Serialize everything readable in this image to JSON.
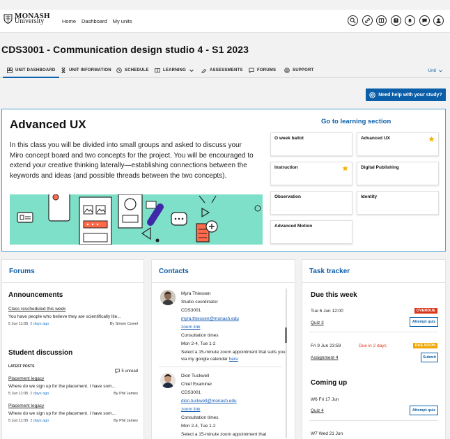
{
  "brand": {
    "line1": "MONASH",
    "line2": "University"
  },
  "nav": [
    "Home",
    "Dashboard",
    "My units"
  ],
  "header_icons": [
    "search-icon",
    "link-icon",
    "book-icon",
    "help-icon",
    "bell-icon",
    "chat-icon",
    "user-icon"
  ],
  "page_title": "CDS3001 - Communication design studio 4 - S1 2023",
  "tabs": [
    {
      "label": "Unit dashboard",
      "icon": "dashboard-icon"
    },
    {
      "label": "Unit information",
      "icon": "hourglass-icon"
    },
    {
      "label": "Schedule",
      "icon": "clock-icon"
    },
    {
      "label": "Learning",
      "icon": "book-icon"
    },
    {
      "label": "Assessments",
      "icon": "assessment-icon"
    },
    {
      "label": "Forums",
      "icon": "chat-icon"
    },
    {
      "label": "Support",
      "icon": "lifebuoy-icon"
    }
  ],
  "unit_menu": "Unit",
  "help_button": "Need help with your study?",
  "hero": {
    "title": "Advanced UX",
    "body": "In this class you will be divided into small groups and asked to discuss your Miro concept board and two concepts for the project. You will be encouraged to extend your creative thinking laterally—establishing connections between the keywords and ideas (and possible threads between the two concepts).",
    "go_link": "Go to learning section",
    "cards": [
      "O week ballot",
      "Advanced UX",
      "Instruction",
      "Digital Publishing",
      "Observation",
      "Identity",
      "Advanced Motion"
    ]
  },
  "forums": {
    "title": "Forums",
    "announcements_title": "Announcements",
    "ann_post_title": "Class rescheduled this week",
    "ann_post_excerpt": "You have people who believe they are scientifically lite...",
    "ann_post_date": "5 Jun 11:05",
    "ann_post_ago": "2 days ago",
    "ann_post_by": "By Simon Cowel",
    "student_title": "Student discussion",
    "latest_label": "LATEST POSTS",
    "unread": "5 unread",
    "posts": [
      {
        "title": "Placement legacy",
        "excerpt": "Where do we sign up for the placement. I have som...",
        "date": "5 Jun 11:05",
        "ago": "2 days ago",
        "by": "By Phil James"
      },
      {
        "title": "Placement legacy",
        "excerpt": "Where do we sign up for the placement. I have som...",
        "date": "5 Jun 11:05",
        "ago": "2 days ago",
        "by": "By Phil James"
      }
    ]
  },
  "contacts": {
    "title": "Contacts",
    "people": [
      {
        "name": "Myra Thiessen",
        "role": "Studio coordinator",
        "unit": "CDS3001",
        "email": "myra.thiessen@monash.edu",
        "zoom": "zoom link",
        "hours_label": "Consultation times",
        "hours": "Mon 2-4, Tue 1-2",
        "note": "Select a 15-minute zoom appointment that suits you via my google calendar",
        "note_link": "here"
      },
      {
        "name": "Dion Tuckwell",
        "role": "Chief Examiner",
        "unit": "CDS3001",
        "email": "dion.tuckwell@monash.edu",
        "zoom": "zoom link",
        "hours_label": "Consultation times",
        "hours": "Mon 2-4, Tue 1-2",
        "note": "Select a 15-minute zoom appointment that",
        "note_link": ""
      }
    ]
  },
  "tasks": {
    "title": "Task tracker",
    "due_title": "Due this week",
    "due": [
      {
        "when": "Tue 6 Jun 12:00",
        "due_text": "",
        "name": "Quiz 3",
        "badge": "OVERDUE",
        "badge_color": "#d9361a",
        "button": "Attempt quiz"
      },
      {
        "when": "Fri 9 Jun 23:59",
        "due_text": "Due in 2 days",
        "name": "Assignment 4",
        "badge": "DUE SOON",
        "badge_color": "#f0a500",
        "button": "Submit"
      }
    ],
    "coming_title": "Coming up",
    "coming": [
      {
        "when": "W6 Fri 17 Jun",
        "name": "Quiz 4",
        "button": "Attempt quiz"
      },
      {
        "when": "W7 Wed 21 Jun",
        "name": "",
        "button": ""
      }
    ]
  },
  "colors": {
    "brand_blue": "#0b5fa8",
    "hero_border": "#4ea3d6",
    "banner": "#7ee0c8",
    "star": "#f4b400",
    "overdue": "#d9361a",
    "due_soon": "#f0a500"
  }
}
